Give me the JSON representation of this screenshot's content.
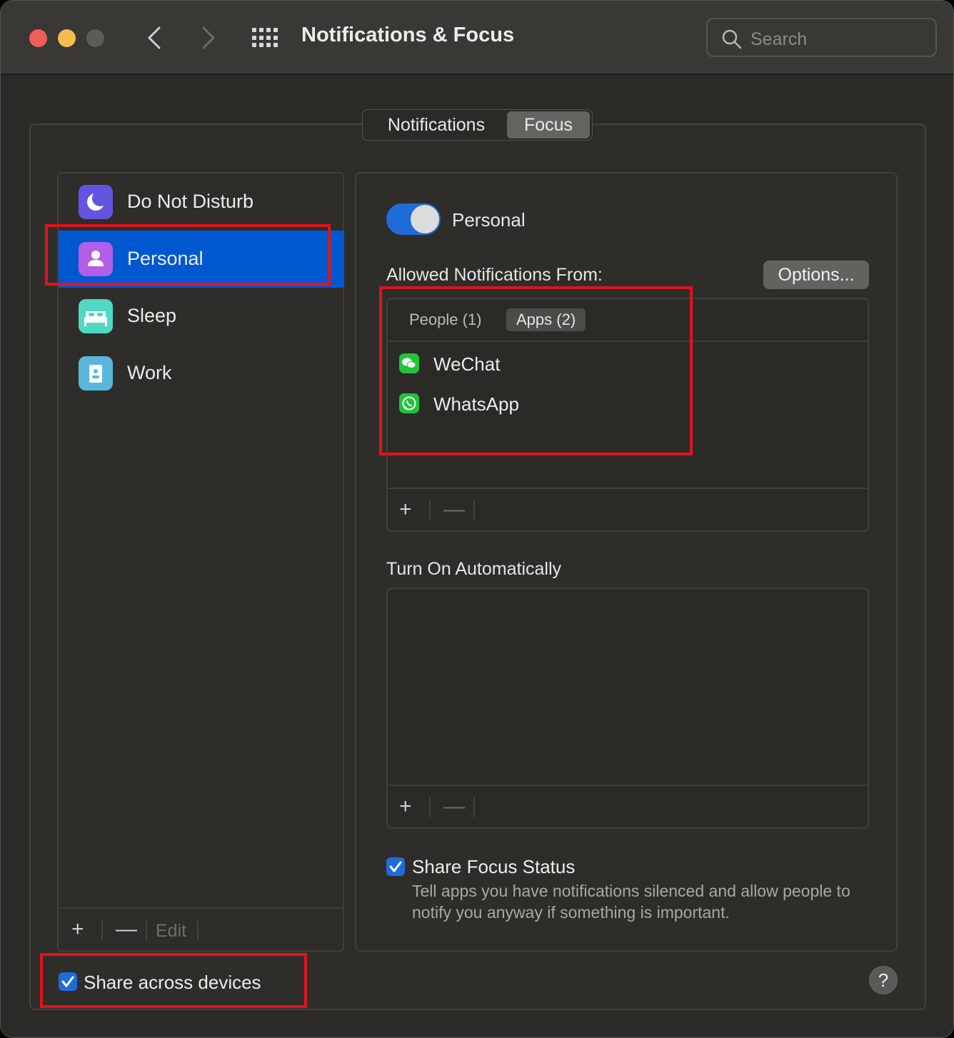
{
  "window": {
    "title": "Notifications & Focus"
  },
  "search": {
    "placeholder": "Search"
  },
  "tabs": [
    {
      "label": "Notifications",
      "selected": false
    },
    {
      "label": "Focus",
      "selected": true
    }
  ],
  "focus_list": {
    "items": [
      {
        "label": "Do Not Disturb",
        "icon": "moon-icon",
        "color": "#6355e0"
      },
      {
        "label": "Personal",
        "icon": "person-icon",
        "color": "#b25ee6",
        "selected": true
      },
      {
        "label": "Sleep",
        "icon": "bed-icon",
        "color": "#4fd8c4"
      },
      {
        "label": "Work",
        "icon": "id-badge-icon",
        "color": "#5ab6dd"
      }
    ],
    "toolbar": {
      "add": "+",
      "remove": "—",
      "edit": "Edit"
    }
  },
  "detail": {
    "toggle_label": "Personal",
    "toggle_on": true,
    "allowed_heading": "Allowed Notifications From:",
    "options_button": "Options...",
    "subtabs": [
      {
        "label": "People (1)",
        "selected": false
      },
      {
        "label": "Apps (2)",
        "selected": true
      }
    ],
    "apps": [
      {
        "label": "WeChat",
        "icon": "wechat-icon"
      },
      {
        "label": "WhatsApp",
        "icon": "whatsapp-icon"
      }
    ],
    "add": "+",
    "remove": "—",
    "auto_heading": "Turn On Automatically",
    "share_focus_label": "Share Focus Status",
    "share_focus_checked": true,
    "share_focus_desc": "Tell apps you have notifications silenced and allow people to notify you anyway if something is important."
  },
  "footer": {
    "share_devices_label": "Share across devices",
    "share_devices_checked": true,
    "help": "?"
  },
  "colors": {
    "accent": "#1f6cd9",
    "selection": "#0058d0",
    "highlight_box": "#e0131b"
  }
}
